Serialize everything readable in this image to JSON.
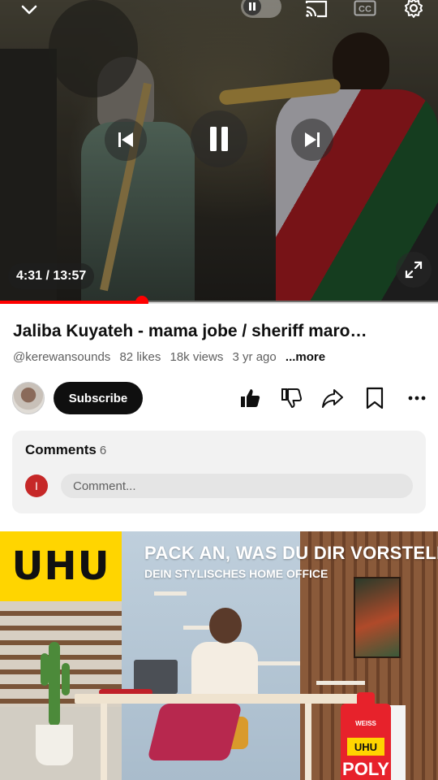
{
  "player": {
    "time_current": "4:31",
    "time_total": "13:57",
    "time_display": "4:31 / 13:57",
    "progress": 0.324,
    "icons": {
      "collapse": "chevron-down-icon",
      "autoplay": "autoplay-toggle-icon",
      "cast": "cast-icon",
      "captions": "cc-icon",
      "settings": "gear-icon",
      "previous": "skip-previous-icon",
      "play_pause": "pause-icon",
      "next": "skip-next-icon",
      "fullscreen": "fullscreen-icon"
    },
    "captions_label": "CC",
    "accent_color": "#ff0000"
  },
  "video": {
    "title": "Jaliba Kuyateh - mama jobe / sheriff maro…",
    "channel_handle": "@kerewansounds",
    "likes": "82 likes",
    "views": "18k views",
    "age": "3 yr ago",
    "more_label": "...more"
  },
  "channel": {
    "subscribe_label": "Subscribe",
    "actions": [
      "like-icon",
      "dislike-icon",
      "share-icon",
      "save-icon",
      "more-icon"
    ]
  },
  "comments": {
    "title": "Comments",
    "count": "6",
    "user_initial": "I",
    "placeholder": "Comment..."
  },
  "ad": {
    "brand": "UHU",
    "headline": "PACK AN, WAS DU DIR VORSTELLST!",
    "subheadline": "DEIN STYLISCHES HOME OFFICE",
    "product_brand": "WEISS",
    "product_logo": "UHU",
    "product_name": "POLY",
    "brand_color": "#ffd500"
  }
}
